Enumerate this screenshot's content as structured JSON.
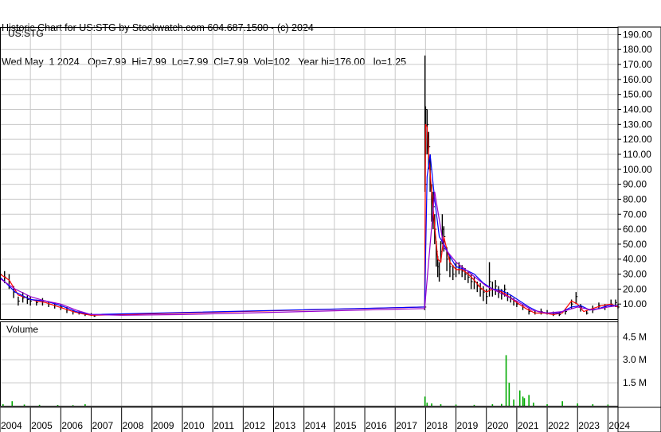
{
  "header": {
    "line1": "Historic Chart for US:STG by Stockwatch.com 604.687.1500 - (c) 2024",
    "line2": "Wed May  1 2024   Op=7.99  Hi=7.99  Lo=7.99  Cl=7.99  Vol=102   Year hi=176.00   lo=1.25"
  },
  "colors": {
    "price_bar": "#000000",
    "ma_fast": "#ff0000",
    "ma_slow": "#0000ff",
    "ma_long": "#9900cc",
    "volume": "#00aa00",
    "grid": "#c8c8c8"
  },
  "chart_data": [
    {
      "type": "line",
      "title": "US:STG",
      "ylim": [
        0,
        195
      ],
      "y_ticks": [
        "10.00",
        "20.00",
        "30.00",
        "40.00",
        "50.00",
        "60.00",
        "70.00",
        "80.00",
        "90.00",
        "100.00",
        "110.00",
        "120.00",
        "130.00",
        "140.00",
        "150.00",
        "160.00",
        "170.00",
        "180.00",
        "190.00"
      ],
      "x_ticks": [
        "2004",
        "2005",
        "2006",
        "2007",
        "2008",
        "2009",
        "2010",
        "2011",
        "2012",
        "2013",
        "2014",
        "2015",
        "2016",
        "2017",
        "2018",
        "2019",
        "2020",
        "2021",
        "2022",
        "2023",
        "2024"
      ],
      "x_range": [
        2004,
        2024.33
      ],
      "series": [
        {
          "style": "price",
          "x": [
            2004.0,
            2004.15,
            2004.3,
            2004.45,
            2004.6,
            2004.75,
            2004.9,
            2005.0,
            2005.2,
            2005.4,
            2005.6,
            2005.8,
            2006.0,
            2006.2,
            2006.4,
            2006.6,
            2006.8,
            2007.0,
            2007.1,
            2017.97,
            2017.98,
            2018.0,
            2018.05,
            2018.1,
            2018.15,
            2018.2,
            2018.25,
            2018.3,
            2018.35,
            2018.4,
            2018.45,
            2018.5,
            2018.55,
            2018.6,
            2018.7,
            2018.8,
            2018.9,
            2019.0,
            2019.1,
            2019.2,
            2019.3,
            2019.4,
            2019.5,
            2019.6,
            2019.7,
            2019.8,
            2019.9,
            2020.0,
            2020.1,
            2020.2,
            2020.3,
            2020.4,
            2020.5,
            2020.6,
            2020.7,
            2020.8,
            2020.9,
            2021.0,
            2021.2,
            2021.4,
            2021.6,
            2021.8,
            2022.0,
            2022.2,
            2022.4,
            2022.6,
            2022.8,
            2022.95,
            2023.1,
            2023.3,
            2023.5,
            2023.7,
            2023.9,
            2024.1,
            2024.25,
            2024.33
          ],
          "y": [
            30,
            28,
            25,
            18,
            12,
            14,
            13,
            12,
            11,
            12,
            10,
            9,
            8,
            6,
            5,
            4,
            3,
            3,
            2,
            8,
            90,
            140,
            130,
            115,
            100,
            80,
            75,
            60,
            45,
            35,
            30,
            45,
            60,
            55,
            40,
            35,
            30,
            33,
            35,
            32,
            30,
            28,
            25,
            25,
            22,
            20,
            18,
            15,
            25,
            20,
            22,
            18,
            17,
            20,
            15,
            14,
            12,
            10,
            8,
            5,
            4,
            5,
            4,
            3,
            3,
            5,
            10,
            15,
            8,
            4,
            6,
            9,
            8,
            10,
            11,
            8
          ],
          "hi": [
            35,
            32,
            30,
            22,
            15,
            18,
            16,
            15,
            13,
            14,
            12,
            11,
            10,
            8,
            6,
            5,
            4,
            4,
            3,
            8,
            176,
            142,
            140,
            125,
            110,
            90,
            85,
            70,
            52,
            42,
            38,
            52,
            70,
            62,
            48,
            42,
            36,
            38,
            38,
            36,
            34,
            32,
            30,
            28,
            25,
            24,
            22,
            20,
            38,
            25,
            26,
            22,
            20,
            23,
            18,
            16,
            14,
            12,
            10,
            7,
            6,
            7,
            6,
            5,
            5,
            7,
            13,
            18,
            10,
            6,
            9,
            11,
            10,
            13,
            13,
            10
          ],
          "lo": [
            25,
            24,
            20,
            14,
            9,
            11,
            10,
            9,
            9,
            9,
            8,
            7,
            6,
            4,
            3,
            3,
            2,
            2,
            1.5,
            6,
            85,
            110,
            110,
            100,
            85,
            65,
            60,
            50,
            35,
            28,
            25,
            38,
            50,
            45,
            32,
            28,
            26,
            28,
            30,
            28,
            26,
            24,
            20,
            20,
            18,
            15,
            12,
            10,
            15,
            15,
            16,
            14,
            13,
            15,
            12,
            11,
            9,
            8,
            6,
            3,
            3,
            3,
            3,
            2,
            2,
            3,
            7,
            10,
            5,
            3,
            4,
            7,
            6,
            8,
            8,
            7
          ]
        },
        {
          "name": "",
          "style": "ma_fast",
          "x": [
            2004.0,
            2004.3,
            2004.6,
            2004.9,
            2005.2,
            2005.5,
            2005.8,
            2006.1,
            2006.4,
            2006.7,
            2007.0,
            2017.97,
            2018.0,
            2018.05,
            2018.1,
            2018.2,
            2018.3,
            2018.4,
            2018.5,
            2018.6,
            2018.8,
            2019.0,
            2019.2,
            2019.4,
            2019.6,
            2019.8,
            2020.0,
            2020.2,
            2020.4,
            2020.6,
            2020.8,
            2021.0,
            2021.3,
            2021.6,
            2021.9,
            2022.2,
            2022.5,
            2022.8,
            2023.0,
            2023.2,
            2023.5,
            2023.8,
            2024.1,
            2024.33
          ],
          "y": [
            30,
            26,
            16,
            14,
            12,
            11,
            9,
            7,
            5,
            3.5,
            2.5,
            8,
            130,
            128,
            110,
            85,
            62,
            40,
            38,
            55,
            38,
            33,
            33,
            30,
            26,
            21,
            18,
            20,
            19,
            17,
            14,
            11,
            7,
            4,
            4,
            3,
            4,
            12,
            10,
            5,
            7,
            9,
            10,
            8
          ]
        },
        {
          "name": "",
          "style": "ma_slow",
          "x": [
            2004.0,
            2004.5,
            2005.0,
            2005.5,
            2006.0,
            2006.5,
            2007.0,
            2017.97,
            2018.05,
            2018.15,
            2018.3,
            2018.45,
            2018.6,
            2018.8,
            2019.0,
            2019.3,
            2019.6,
            2019.9,
            2020.2,
            2020.5,
            2020.8,
            2021.1,
            2021.4,
            2021.7,
            2022.0,
            2022.4,
            2022.8,
            2023.1,
            2023.4,
            2023.7,
            2024.0,
            2024.33
          ],
          "y": [
            28,
            18,
            13,
            12,
            9,
            5,
            3,
            8,
            95,
            110,
            80,
            55,
            50,
            42,
            35,
            33,
            30,
            24,
            20,
            19,
            16,
            12,
            8,
            5,
            4,
            4,
            8,
            9,
            6,
            7,
            9,
            9
          ]
        },
        {
          "name": "",
          "style": "ma_long",
          "x": [
            2004.0,
            2004.5,
            2005.0,
            2005.5,
            2006.0,
            2006.5,
            2007.0,
            2008.0,
            2010.0,
            2012.0,
            2014.0,
            2016.0,
            2017.97,
            2018.3,
            2018.6,
            2019.0,
            2019.5,
            2020.0,
            2020.5,
            2021.0,
            2021.5,
            2022.0,
            2022.5,
            2023.0,
            2023.5,
            2024.0,
            2024.33
          ],
          "y": [
            27,
            20,
            15,
            12,
            10,
            6,
            3,
            2.5,
            3,
            4,
            5,
            6,
            7,
            85,
            48,
            38,
            30,
            22,
            17,
            12,
            6,
            4,
            5,
            8,
            6,
            8,
            9
          ]
        }
      ]
    },
    {
      "type": "bar",
      "title": "Volume",
      "ylim": [
        0,
        5500000
      ],
      "y_ticks": [
        "1.5 M",
        "3.0 M",
        "4.5 M"
      ],
      "x": [
        2004.1,
        2004.4,
        2004.8,
        2005.3,
        2005.9,
        2006.4,
        2006.8,
        2017.98,
        2018.05,
        2018.2,
        2018.5,
        2019.0,
        2019.6,
        2020.2,
        2020.5,
        2020.65,
        2020.75,
        2020.9,
        2021.1,
        2021.2,
        2021.25,
        2021.4,
        2021.55,
        2022.0,
        2022.5,
        2023.0,
        2023.5,
        2024.0
      ],
      "values": [
        100000,
        300000,
        80000,
        60000,
        50000,
        40000,
        100000,
        600000,
        200000,
        150000,
        100000,
        80000,
        60000,
        100000,
        120000,
        3300000,
        1500000,
        400000,
        1000000,
        600000,
        500000,
        700000,
        200000,
        100000,
        300000,
        150000,
        100000,
        80000
      ]
    }
  ]
}
